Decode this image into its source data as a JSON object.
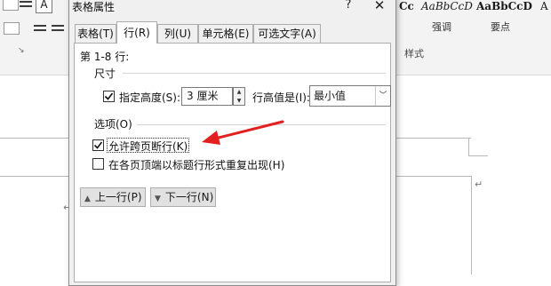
{
  "ribbon": {
    "font_box_glyph": "A",
    "styles": [
      {
        "sample": "AaBbCcD",
        "name": "强调"
      },
      {
        "sample": "AaBbCcD",
        "name": "要点"
      }
    ],
    "partial_sample_1": "Cc",
    "partial_sample_2": "A",
    "partial_name": "",
    "group_styles_label": "样式",
    "launcher_glyph": "↘"
  },
  "document": {
    "paragraph_mark": "↵"
  },
  "dialog": {
    "title": "表格属性",
    "help": "?",
    "close": "✕",
    "tabs": [
      {
        "label": "表格(T)",
        "active": false
      },
      {
        "label": "行(R)",
        "active": true
      },
      {
        "label": "列(U)",
        "active": false
      },
      {
        "label": "单元格(E)",
        "active": false
      },
      {
        "label": "可选文字(A)",
        "active": false
      }
    ],
    "row_range": "第 1-8 行:",
    "size_section": "尺寸",
    "specify_height_label": "指定高度(S):",
    "specify_height_checked": true,
    "height_value": "3 厘米",
    "row_height_is_label": "行高值是(I):",
    "row_height_is_value": "最小值",
    "options_section": "选项(O)",
    "allow_break_label": "允许跨页断行(K)",
    "allow_break_checked": true,
    "repeat_header_label": "在各页顶端以标题行形式重复出现(H)",
    "repeat_header_checked": false,
    "prev_row": "上一行(P)",
    "next_row": "下一行(N)"
  },
  "annotation": {
    "arrow_color": "#e32020"
  }
}
